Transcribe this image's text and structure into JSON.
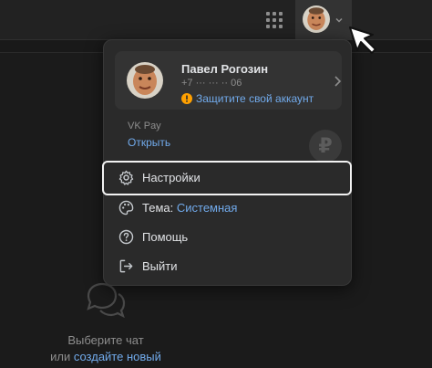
{
  "topbar": {
    "apps_icon": "grid-icon",
    "avatar_icon": "avatar-photo",
    "chevron_icon": "chevron-down-icon"
  },
  "profile": {
    "name": "Павел Рогозин",
    "phone": "+7 ··· ··· ·· 06",
    "protect_link": "Защитите свой аккаунт",
    "warning_icon": "warning-icon"
  },
  "vk_pay": {
    "title": "VK Pay",
    "open_link": "Открыть",
    "currency_symbol": "₽"
  },
  "menu": {
    "settings": "Настройки",
    "theme_label": "Тема:",
    "theme_value": "Системная",
    "help": "Помощь",
    "logout": "Выйти"
  },
  "empty_state": {
    "line1": "Выберите чат",
    "line2_prefix": "или",
    "line2_link": "создайте новый"
  },
  "colors": {
    "background": "#191919",
    "panel": "#2a2a2a",
    "accent_link": "#71aaeb",
    "warning": "#ffa000",
    "text_primary": "#e1e3e6",
    "text_secondary": "#8d8d8d"
  }
}
